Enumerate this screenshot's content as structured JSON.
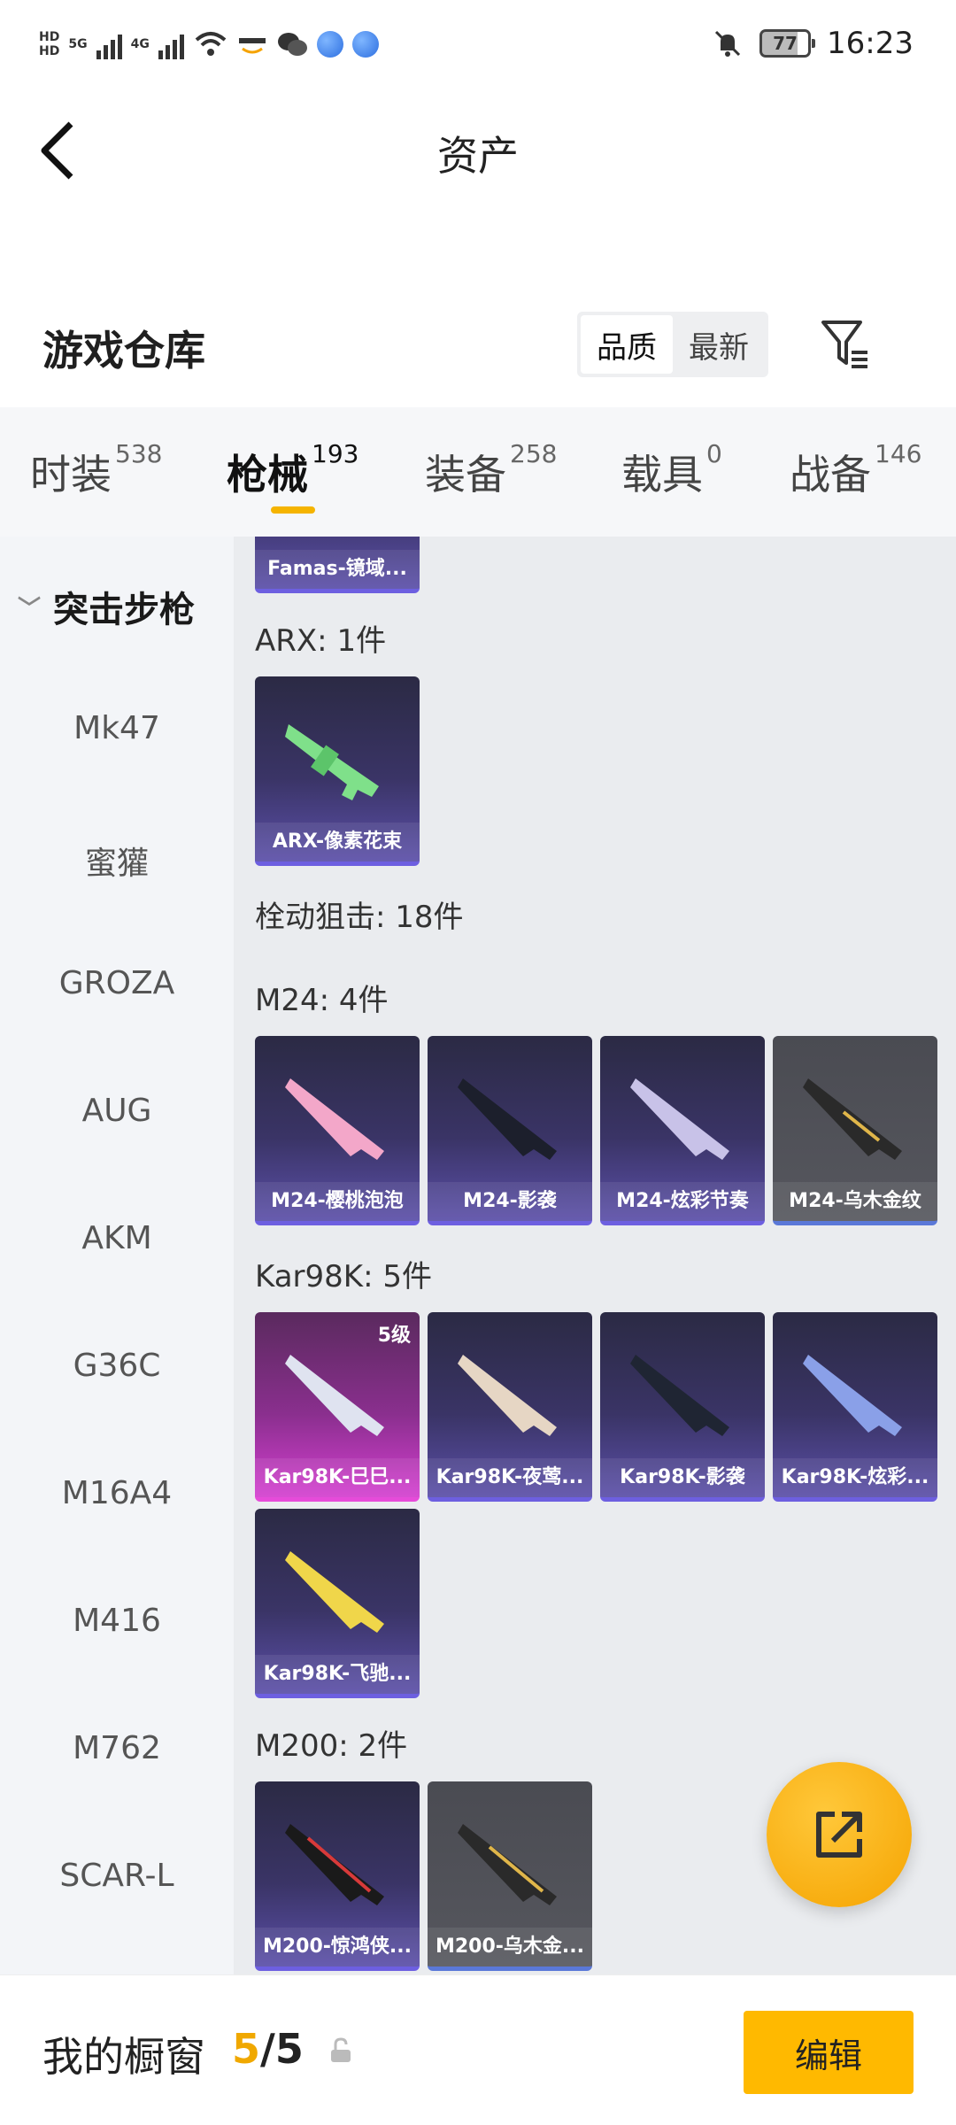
{
  "statusbar": {
    "left_tiny": [
      "HD",
      "5G",
      "4G"
    ],
    "battery": "77",
    "time": "16:23"
  },
  "header": {
    "title": "资产"
  },
  "warehouse": {
    "title": "游戏仓库",
    "sort_options": [
      "品质",
      "最新"
    ],
    "active_sort": "品质"
  },
  "tabs": [
    {
      "label": "时装",
      "count": "538"
    },
    {
      "label": "枪械",
      "count": "193"
    },
    {
      "label": "装备",
      "count": "258"
    },
    {
      "label": "载具",
      "count": "0"
    },
    {
      "label": "战备",
      "count": "146"
    }
  ],
  "sidebar": {
    "category": "突击步枪",
    "items": [
      "Mk47",
      "蜜獾",
      "GROZA",
      "AUG",
      "AKM",
      "G36C",
      "M16A4",
      "M416",
      "M762",
      "SCAR-L"
    ]
  },
  "content": {
    "top_card": "Famas-镜域...",
    "sections": [
      {
        "title": "ARX: 1件",
        "cards": [
          "ARX-像素花束"
        ]
      },
      {
        "title": "栓动狙击: 18件",
        "cards": []
      },
      {
        "title": "M24: 4件",
        "cards": [
          "M24-樱桃泡泡",
          "M24-影袭",
          "M24-炫彩节奏",
          "M24-乌木金纹"
        ]
      },
      {
        "title": "Kar98K: 5件",
        "cards": [
          "Kar98K-巳巳...",
          "Kar98K-夜莺...",
          "Kar98K-影袭",
          "Kar98K-炫彩...",
          "Kar98K-飞驰..."
        ]
      },
      {
        "title": "M200: 2件",
        "cards": [
          "M200-惊鸿侠...",
          "M200-乌木金..."
        ]
      }
    ],
    "level_badge": "5级"
  },
  "bottom": {
    "label": "我的橱窗",
    "count_current": "5",
    "count_sep": "/",
    "count_total": "5",
    "edit": "编辑"
  },
  "colors": {
    "accent": "#f5b400",
    "card_purple": "#5b4fa8",
    "card_pink": "#d43fd0",
    "card_gray": "#56575e"
  }
}
